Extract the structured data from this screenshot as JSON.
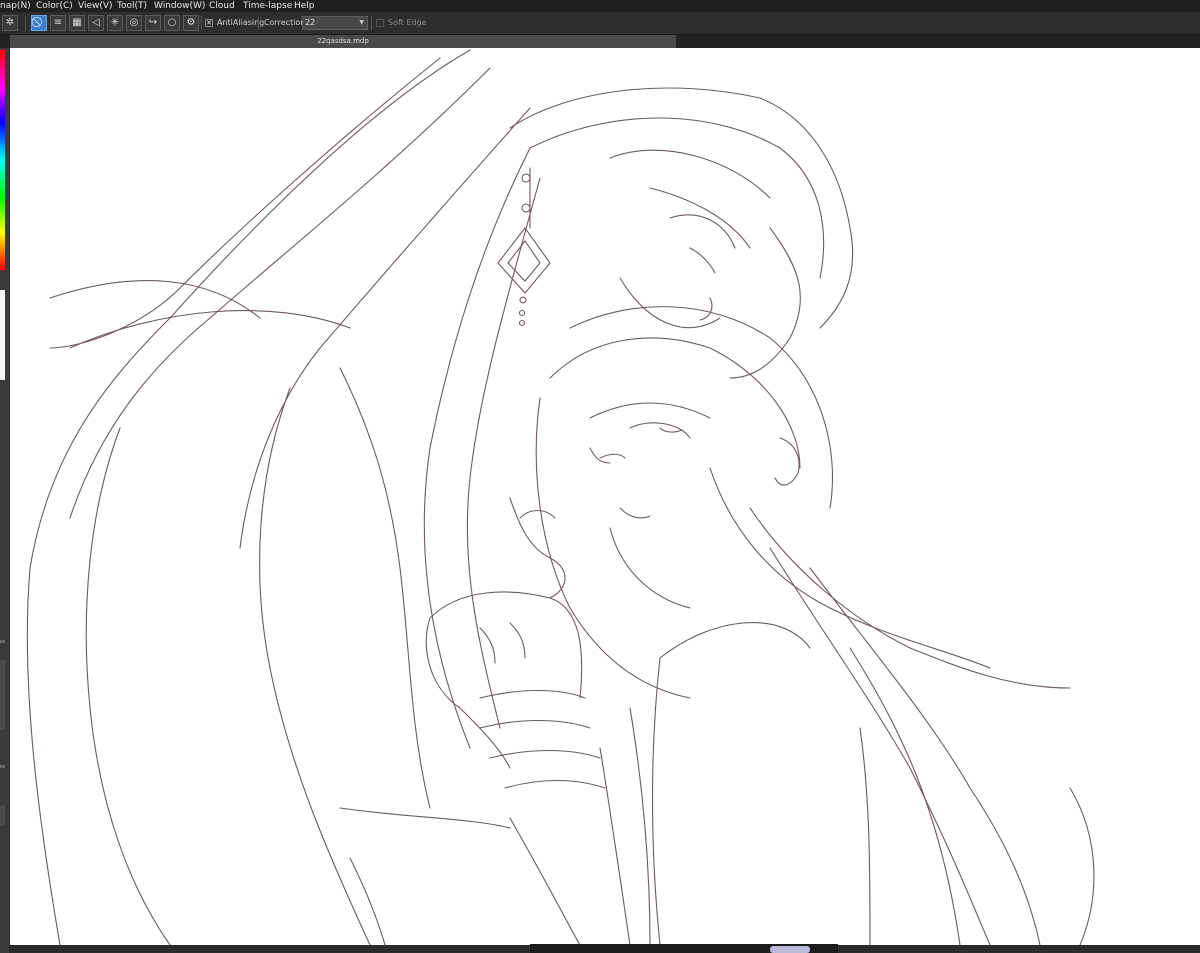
{
  "menu": {
    "items": [
      "nap(N)",
      "Color(C)",
      "View(V)",
      "Tool(T)",
      "Window(W)",
      "Cloud",
      "Time-lapse",
      "Help"
    ]
  },
  "toolbar": {
    "antialiasing_label": "AntiAliasing",
    "correction_label": "Correction",
    "correction_value": "22",
    "soft_edge_label": "Soft Edge",
    "antialiasing_checked": "✕"
  },
  "document": {
    "tab_title": "22qasdsa.mdp"
  },
  "icons": {
    "tool_icons": [
      "snap-off-icon",
      "parallel-line-snap-icon",
      "grid-snap-icon",
      "perspective-snap-icon",
      "radial-snap-icon",
      "concentric-snap-icon",
      "curve-snap-icon",
      "circle-snap-icon",
      "settings-snap-icon"
    ]
  },
  "colors": {
    "accent": "#3c7fcf",
    "chrome_dark": "#1f1f1f",
    "canvas": "#ffffff",
    "line_art": "#6b5c5c"
  }
}
